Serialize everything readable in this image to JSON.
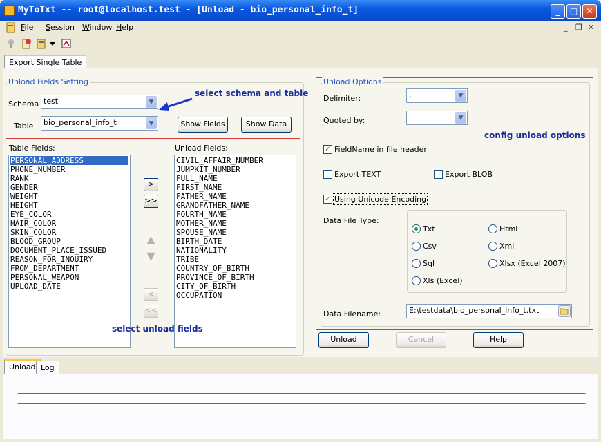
{
  "window": {
    "title": "MyToTxt -- root@localhost.test - [Unload - bio_personal_info_t]",
    "controls": {
      "minimize": "_",
      "maximize": "□",
      "close": "✕"
    }
  },
  "menu": [
    "File",
    "Session",
    "Window",
    "Help"
  ],
  "mdi_controls": {
    "minimize": "_",
    "restore": "❐",
    "close": "✕"
  },
  "toolbar_icons": [
    "connect-icon",
    "disconnect-icon",
    "new-unload-icon",
    "dropdown-arrow-icon",
    "export-icon"
  ],
  "top_tab": "Export Single Table",
  "unload_fields_setting": {
    "legend": "Unload Fields Setting",
    "schema_label": "Schema",
    "schema_value": "test",
    "table_label": "Table",
    "table_value": "bio_personal_info_t",
    "show_fields": "Show Fields",
    "show_data": "Show Data",
    "table_fields_label": "Table Fields:",
    "unload_fields_label": "Unload Fields:",
    "table_fields": [
      "PERSONAL_ADDRESS",
      "PHONE_NUMBER",
      "RANK",
      "GENDER",
      "WEIGHT",
      "HEIGHT",
      "EYE_COLOR",
      "HAIR_COLOR",
      "SKIN_COLOR",
      "BLOOD_GROUP",
      "DOCUMENT_PLACE_ISSUED",
      "REASON_FOR_INQUIRY",
      "FROM_DEPARTMENT",
      "PERSONAL_WEAPON",
      "UPLOAD_DATE"
    ],
    "unload_fields": [
      "CIVIL_AFFAIR_NUMBER",
      "JUMPKIT_NUMBER",
      "FULL_NAME",
      "FIRST_NAME",
      "FATHER_NAME",
      "GRANDFATHER_NAME",
      "FOURTH_NAME",
      "MOTHER_NAME",
      "SPOUSE_NAME",
      "BIRTH_DATE",
      "NATIONALITY",
      "TRIBE",
      "COUNTRY_OF_BIRTH",
      "PROVINCE_OF_BIRTH",
      "CITY_OF_BIRTH",
      "OCCUPATION"
    ],
    "move_one": ">",
    "move_all": ">>",
    "remove_one": "<",
    "remove_all": "<<"
  },
  "annotations": {
    "select_schema": "select schema and table",
    "select_fields": "select unload fields",
    "config_options": "config unload options"
  },
  "unload_options": {
    "legend": "Unload Options",
    "delimiter_label": "Delimiter:",
    "delimiter_value": ",",
    "quoted_label": "Quoted by:",
    "quoted_value": "'",
    "fieldname_header": "FieldName in file header",
    "fieldname_header_checked": true,
    "export_text": "Export TEXT",
    "export_text_checked": false,
    "export_blob": "Export BLOB",
    "export_blob_checked": false,
    "unicode": "Using Unicode Encoding",
    "unicode_checked": true,
    "file_type_label": "Data File Type:",
    "file_types": [
      {
        "label": "Txt",
        "selected": true
      },
      {
        "label": "Html",
        "selected": false
      },
      {
        "label": "Csv",
        "selected": false
      },
      {
        "label": "Xml",
        "selected": false
      },
      {
        "label": "Sql",
        "selected": false
      },
      {
        "label": "Xlsx (Excel 2007)",
        "selected": false
      },
      {
        "label": "Xls (Excel)",
        "selected": false
      }
    ],
    "filename_label": "Data Filename:",
    "filename_value": "E:\\testdata\\bio_personal_info_t.txt"
  },
  "actions": {
    "unload": "Unload",
    "cancel": "Cancel",
    "help": "Help"
  },
  "bottom_tabs": [
    "Unload",
    "Log"
  ],
  "progress": 0
}
